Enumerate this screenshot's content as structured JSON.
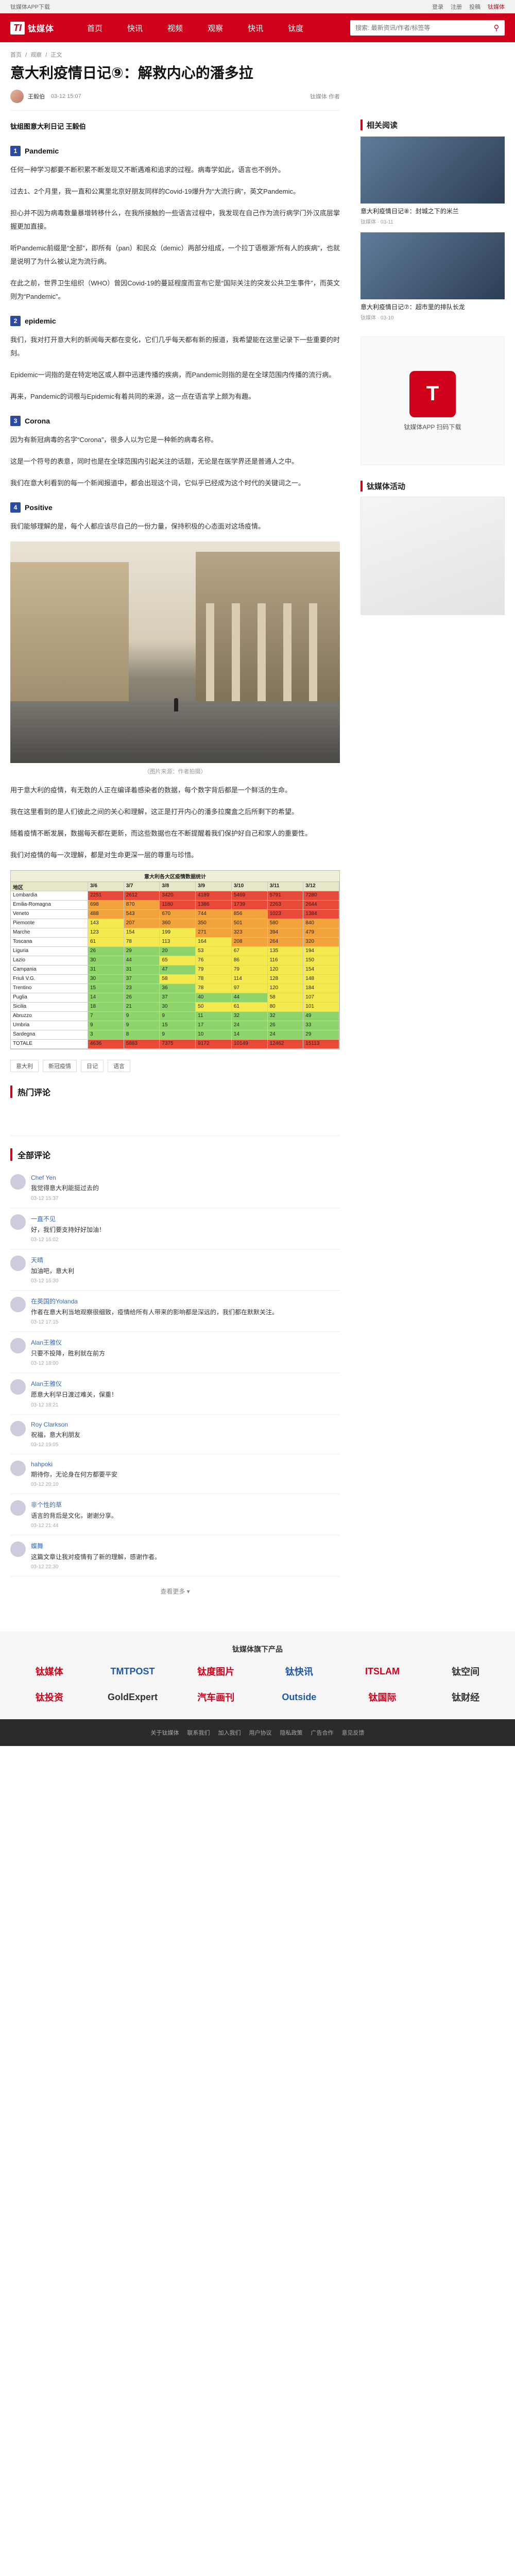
{
  "topbar": {
    "left": "钛媒体APP下载",
    "links": [
      "登录",
      "注册",
      "投稿"
    ],
    "right_red": "钛媒体"
  },
  "nav": {
    "logo_mark": "TI",
    "logo_text": "钛媒体",
    "links": [
      "首页",
      "快讯",
      "视频",
      "观察",
      "快讯",
      "钛度"
    ],
    "search_placeholder": "搜索: 最新资讯/作者/标签等"
  },
  "breadcrumb": [
    "首页",
    "/",
    "观察",
    "/",
    "正文"
  ],
  "article": {
    "title": "意大利疫情日记⑨：解救内心的潘多拉",
    "author": "王毅伯",
    "date": "03-12 15:07",
    "stats": "钛媒体 作者",
    "lead": "钛组图意大利日记 王毅伯",
    "sections": [
      {
        "num": "1",
        "title": "Pandemic"
      },
      {
        "num": "2",
        "title": "epidemic"
      },
      {
        "num": "3",
        "title": "Corona"
      },
      {
        "num": "4",
        "title": "Positive"
      }
    ],
    "paragraphs": [
      "任何一种学习都要不断积累不断发现又不断遇难和追求的过程。病毒学如此，语言也不例外。",
      "过去1、2个月里，我一直和公寓里北京好朋友同样的Covid-19爆升为“大流行病”，英文Pandemic。",
      "担心并不因为病毒数量暴增转移什么，在我所接触的一些语言过程中，我发现在自己作为流行病学门外汉底层掌握更加直接。",
      "听Pandemic前缀是“全部”，即所有（pan）和民众（demic）两部分组成，一个拉丁语根源“所有人的疾病”，也就是说明了为什么被认定为流行病。",
      "在此之前，世界卫生组织（WHO）曾因Covid-19的蔓延程度而宣布它是“国际关注的突发公共卫生事件”，而英文则为“Pandemic”。"
    ],
    "paragraphs2": [
      "我们，我对打开意大利的新闻每天都在变化，它们几乎每天都有新的报道，我希望能在这里记录下一些重要的时刻。",
      "Epidemic一词指的是在特定地区或人群中迅速传播的疾病，而Pandemic则指的是在全球范围内传播的流行病。",
      "再来，Pandemic的词根与Epidemic有着共同的来源，这一点在语言学上颇为有趣。"
    ],
    "paragraphs3": [
      "因为有新冠病毒的名字“Corona”，很多人以为它是一种新的病毒名称。",
      "这是一个符号的表意，同时也是在全球范围内引起关注的话题，无论是在医学界还是普通人之中。",
      "我们在意大利看到的每一个新闻报道中，都会出现这个词，它似乎已经成为这个时代的关键词之一。"
    ],
    "paragraphs4": [
      "我们能够理解的是，每个人都应该尽自己的一份力量，保持积极的心态面对这场疫情。"
    ],
    "caption": "（图片来源：作者拍摄）",
    "paragraphs5": [
      "用于意大利的疫情，有无数的人正在编译着感染者的数据，每个数字背后都是一个鲜活的生命。",
      "我在这里看到的是人们彼此之间的关心和理解，这正是打开内心的潘多拉魔盒之后所剩下的希望。",
      "随着疫情不断发展，数据每天都在更新，而这些数据也在不断提醒着我们保护好自己和家人的重要性。",
      "我们对疫情的每一次理解，都是对生命更深一层的尊重与珍惜。"
    ],
    "table_title": "意大利各大区疫情数据统计",
    "table_header": [
      "地区",
      "3/6",
      "3/7",
      "3/8",
      "3/9",
      "3/10",
      "3/11",
      "3/12"
    ],
    "table_rows": [
      [
        "Lombardia",
        "2251",
        "2612",
        "3420",
        "4189",
        "5469",
        "5791",
        "7280"
      ],
      [
        "Emilia-Romagna",
        "698",
        "870",
        "1180",
        "1386",
        "1739",
        "2263",
        "2644"
      ],
      [
        "Veneto",
        "488",
        "543",
        "670",
        "744",
        "856",
        "1023",
        "1384"
      ],
      [
        "Piemonte",
        "143",
        "207",
        "360",
        "350",
        "501",
        "580",
        "840"
      ],
      [
        "Marche",
        "123",
        "154",
        "199",
        "271",
        "323",
        "394",
        "479"
      ],
      [
        "Toscana",
        "61",
        "78",
        "113",
        "164",
        "208",
        "264",
        "320"
      ],
      [
        "Liguria",
        "26",
        "29",
        "20",
        "53",
        "67",
        "135",
        "194"
      ],
      [
        "Lazio",
        "30",
        "44",
        "65",
        "76",
        "86",
        "116",
        "150"
      ],
      [
        "Campania",
        "31",
        "31",
        "47",
        "79",
        "79",
        "120",
        "154"
      ],
      [
        "Friuli V.G.",
        "30",
        "37",
        "58",
        "78",
        "114",
        "128",
        "148"
      ],
      [
        "Trentino",
        "15",
        "23",
        "36",
        "78",
        "97",
        "120",
        "184"
      ],
      [
        "Puglia",
        "14",
        "26",
        "37",
        "40",
        "44",
        "58",
        "107"
      ],
      [
        "Sicilia",
        "18",
        "21",
        "30",
        "50",
        "61",
        "80",
        "101"
      ],
      [
        "Abruzzo",
        "7",
        "9",
        "9",
        "11",
        "32",
        "32",
        "49"
      ],
      [
        "Umbria",
        "9",
        "9",
        "15",
        "17",
        "24",
        "26",
        "33"
      ],
      [
        "Sardegna",
        "3",
        "8",
        "9",
        "10",
        "14",
        "24",
        "29"
      ],
      [
        "TOTALE",
        "4636",
        "5883",
        "7375",
        "9172",
        "10149",
        "12462",
        "15113"
      ]
    ],
    "tags": [
      "意大利",
      "新冠疫情",
      "日记",
      "语言"
    ]
  },
  "hot_comments_title": "热门评论",
  "all_comments_title": "全部评论",
  "comments": [
    {
      "name": "Chef Yen",
      "text": "我觉得意大利能挺过去的",
      "time": "03-12 15:37"
    },
    {
      "name": "一直不见",
      "text": "好，我们要支持好好加油！",
      "time": "03-12 16:02"
    },
    {
      "name": "天晴",
      "text": "加油吧，意大利",
      "time": "03-12 16:30"
    },
    {
      "name": "在英国的Yolanda",
      "text": "作者在意大利当地观察很细致，疫情给所有人带来的影响都是深远的，我们都在默默关注。",
      "time": "03-12 17:15"
    },
    {
      "name": "Alan王雅仪",
      "text": "只要不投降，胜利就在前方",
      "time": "03-12 18:00"
    },
    {
      "name": "Alan王雅仪",
      "text": "愿意大利早日渡过难关，保重！",
      "time": "03-12 18:21"
    },
    {
      "name": "Roy Clarkson",
      "text": "祝福，意大利朋友",
      "time": "03-12 19:05"
    },
    {
      "name": "hahpoki",
      "text": "期待你，无论身在何方都要平安",
      "time": "03-12 20:10"
    },
    {
      "name": "非个性的草",
      "text": "语言的背后是文化，谢谢分享。",
      "time": "03-12 21:44"
    },
    {
      "name": "蝶舞",
      "text": "这篇文章让我对疫情有了新的理解，感谢作者。",
      "time": "03-12 22:30"
    }
  ],
  "more_comments": "查看更多 ▾",
  "aside": {
    "related_title": "相关阅读",
    "related": [
      {
        "text": "意大利疫情日记⑧：封城之下的米兰",
        "sub": "钛媒体 · 03-11"
      },
      {
        "text": "意大利疫情日记⑦：超市里的排队长龙",
        "sub": "钛媒体 · 03-10"
      }
    ],
    "promo_mark": "T",
    "promo_text": "钛媒体APP 扫码下载",
    "ad_title": "钛媒体活动"
  },
  "brands_title": "钛媒体旗下产品",
  "brands": [
    "钛媒体",
    "TMTPOST",
    "钛度图片",
    "钛快讯",
    "ITSLAM",
    "钛空间",
    "钛投资",
    "GoldExpert",
    "汽车画刊",
    "Outside",
    "钛国际",
    "钛财经"
  ],
  "footer": [
    "关于钛媒体",
    "联系我们",
    "加入我们",
    "用户协议",
    "隐私政策",
    "广告合作",
    "意见反馈"
  ]
}
